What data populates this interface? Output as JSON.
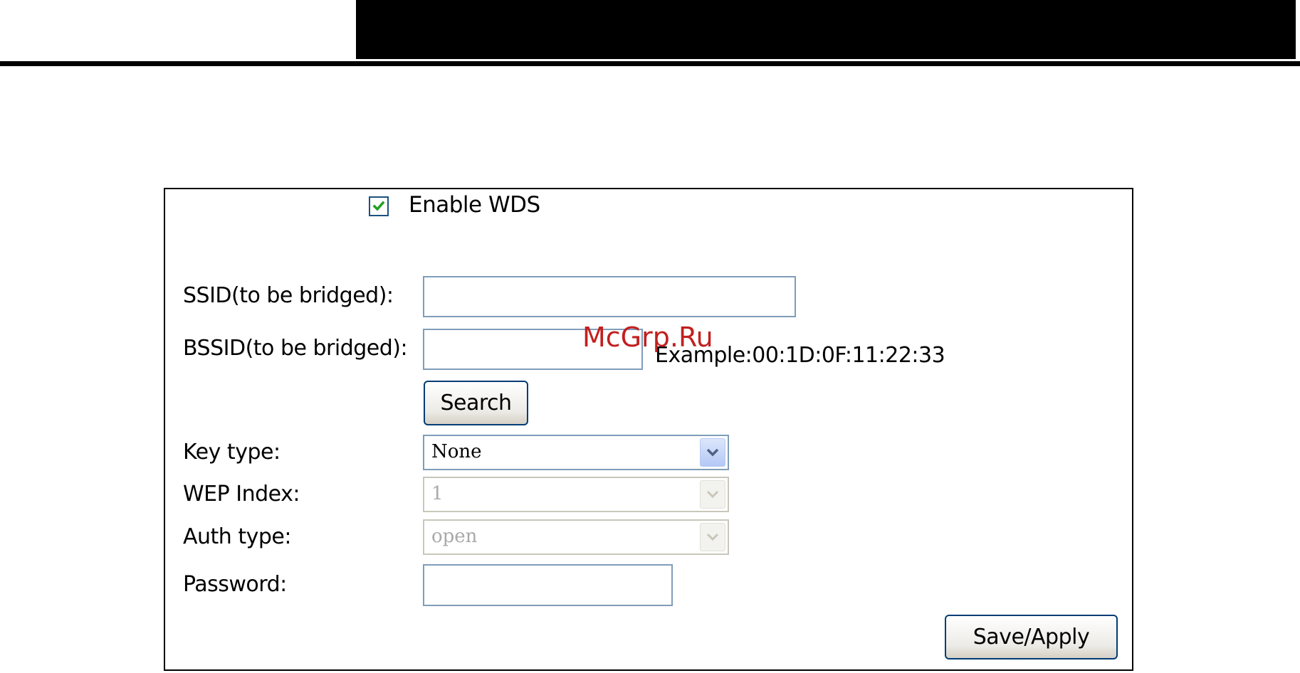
{
  "watermark": "McGrp.Ru",
  "wds": {
    "enable_label": "Enable WDS",
    "enabled": true
  },
  "form": {
    "ssid_label": "SSID(to be bridged):",
    "ssid_value": "",
    "bssid_label": "BSSID(to be bridged):",
    "bssid_value": "",
    "bssid_example": "Example:00:1D:0F:11:22:33",
    "search_label": "Search",
    "key_type_label": "Key type:",
    "key_type_value": "None",
    "wep_index_label": "WEP Index:",
    "wep_index_value": "1",
    "auth_type_label": "Auth type:",
    "auth_type_value": "open",
    "password_label": "Password:",
    "password_value": "",
    "save_label": "Save/Apply"
  },
  "icons": {
    "checkbox": "checkmark-icon",
    "dropdown": "chevron-down-icon"
  },
  "colors": {
    "checkmark": "#21a121",
    "watermark": "#c21f1f",
    "input_border": "#7f9db9",
    "button_border": "#003c74"
  }
}
